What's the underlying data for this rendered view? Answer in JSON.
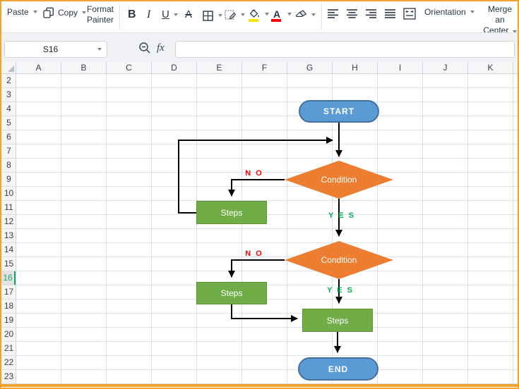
{
  "window": {
    "border_color": "#F0A330"
  },
  "ribbon": {
    "paste_label": "Paste",
    "copy_label": "Copy",
    "format_painter_line1": "Format",
    "format_painter_line2": "Painter",
    "bold_label": "B",
    "italic_label": "I",
    "underline_label": "U",
    "strikethrough_label": "A",
    "fill_color": "#FFE600",
    "font_color": "#FF0000",
    "orientation_label": "Orientation",
    "merge_line1": "Merge an",
    "merge_line2": "Center"
  },
  "formula_bar": {
    "name_box_value": "S16",
    "fx_label": "fx",
    "formula_value": ""
  },
  "sheet": {
    "columns": [
      "A",
      "B",
      "C",
      "D",
      "E",
      "F",
      "G",
      "H",
      "I",
      "J",
      "K"
    ],
    "rows": [
      "2",
      "3",
      "4",
      "5",
      "6",
      "7",
      "8",
      "9",
      "10",
      "11",
      "12",
      "13",
      "14",
      "15",
      "16",
      "17",
      "18",
      "19",
      "20",
      "21",
      "22",
      "23"
    ],
    "selected_row": "16",
    "selection_color": "#21A366",
    "gridline_color": "#DBE0E8"
  },
  "flowchart": {
    "nodes": [
      {
        "id": "start",
        "type": "terminator",
        "label": "START"
      },
      {
        "id": "condition1",
        "type": "decision",
        "label": "Condition"
      },
      {
        "id": "steps1",
        "type": "process",
        "label": "Steps"
      },
      {
        "id": "condition2",
        "type": "decision",
        "label": "Condition"
      },
      {
        "id": "steps2",
        "type": "process",
        "label": "Steps"
      },
      {
        "id": "steps3",
        "type": "process",
        "label": "Steps"
      },
      {
        "id": "end",
        "type": "terminator",
        "label": "END"
      }
    ],
    "edge_labels": [
      {
        "id": "no1",
        "text": "N O",
        "color": "#FF0000"
      },
      {
        "id": "yes1",
        "text": "Y E S",
        "color": "#00B050"
      },
      {
        "id": "no2",
        "text": "N O",
        "color": "#FF0000"
      },
      {
        "id": "yes2",
        "text": "Y E S",
        "color": "#00B050"
      }
    ],
    "colors": {
      "terminator_fill": "#5B9BD5",
      "terminator_border": "#41719C",
      "decision_fill": "#ED7D31",
      "process_fill": "#70AD47",
      "process_border": "#5F9136",
      "connector": "#000000"
    }
  }
}
